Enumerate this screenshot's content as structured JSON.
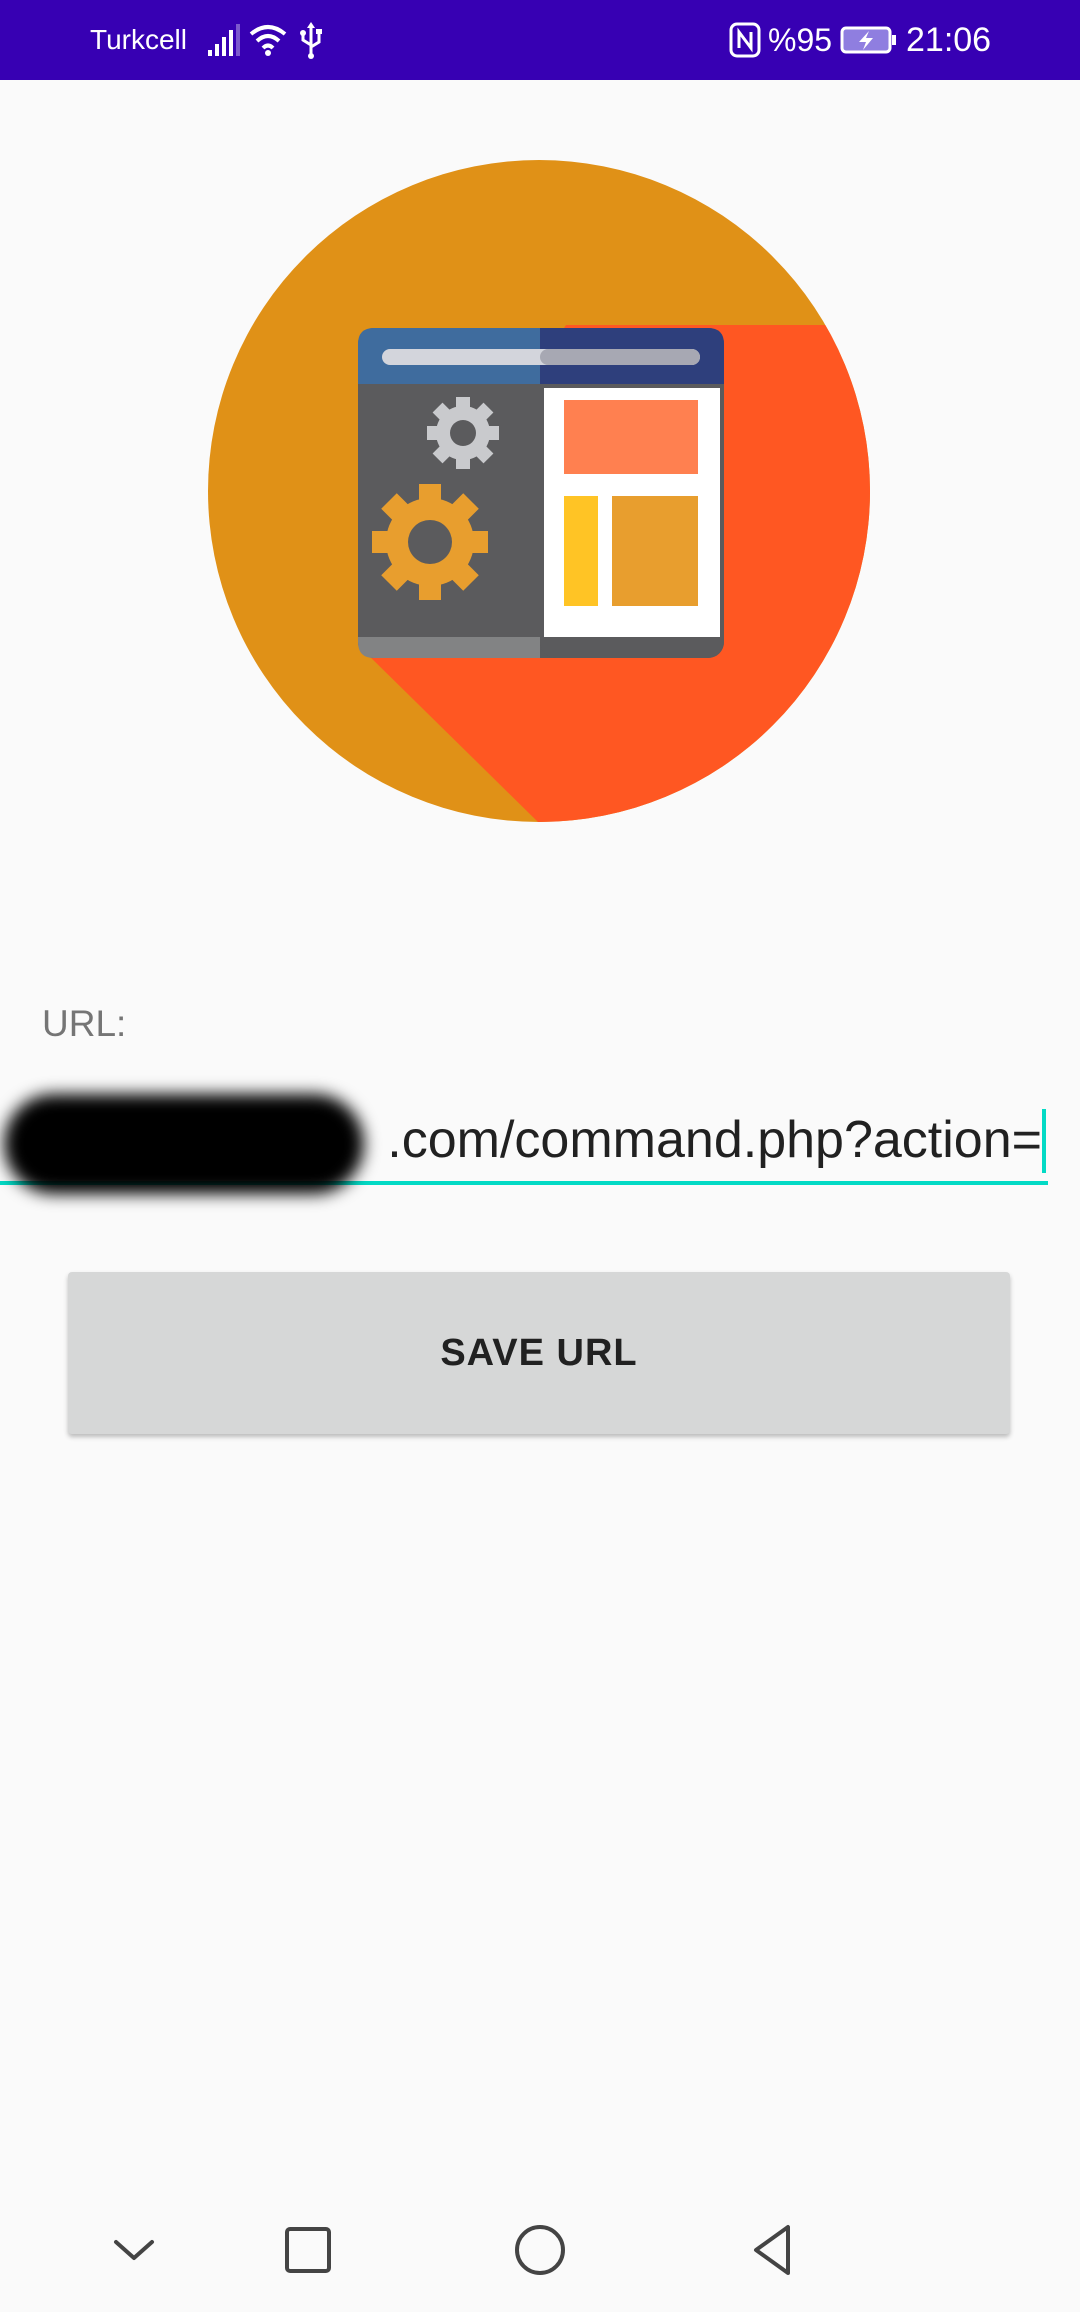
{
  "status_bar": {
    "carrier": "Turkcell",
    "battery_percent": "%95",
    "time": "21:06",
    "icons": [
      "signal-icon",
      "wifi-icon",
      "usb-icon",
      "nfc-icon",
      "battery-charging-icon"
    ],
    "background": "#3700b3"
  },
  "main": {
    "logo_icon": "web-admin-settings-icon",
    "url_label": "URL:",
    "url_value": ".com/command.php?action=",
    "url_prefix_redacted": true,
    "save_button_label": "SAVE URL",
    "accent_color": "#03dac5"
  },
  "nav_bar": {
    "buttons": [
      "hide-keyboard-icon",
      "recent-apps-icon",
      "home-icon",
      "back-icon"
    ]
  }
}
